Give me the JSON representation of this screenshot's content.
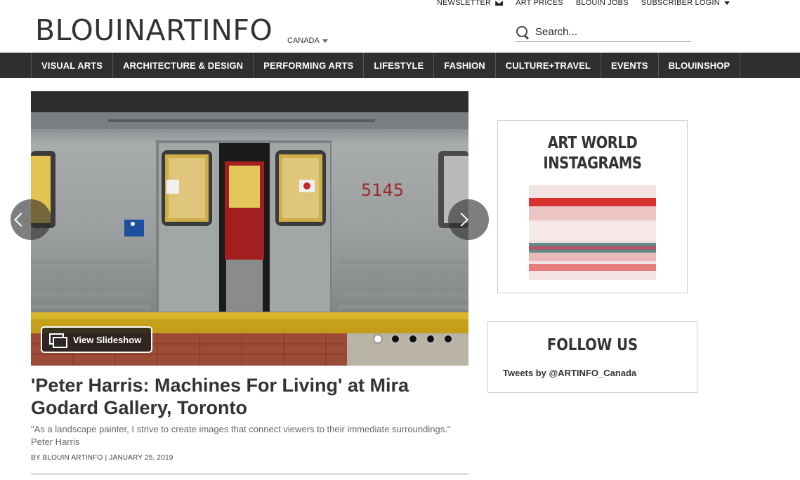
{
  "utility_links": {
    "newsletter": "NEWSLETTER",
    "art_prices": "ART PRICES",
    "blouin_jobs": "BLOUIN JOBS",
    "subscriber_login": "SUBSCRIBER LOGIN"
  },
  "logo": {
    "text": "BLOUINARTINFO"
  },
  "edition": {
    "label": "CANADA"
  },
  "search": {
    "placeholder": "Search..."
  },
  "nav": {
    "items": [
      "VISUAL ARTS",
      "ARCHITECTURE & DESIGN",
      "PERFORMING ARTS",
      "LIFESTYLE",
      "FASHION",
      "CULTURE+TRAVEL",
      "EVENTS",
      "BLOUINSHOP"
    ]
  },
  "hero": {
    "train_number": "5145",
    "slideshow_label": "View Slideshow",
    "slide_count": 5,
    "active_slide": 1
  },
  "article": {
    "headline": "'Peter Harris: Machines For Living' at Mira Godard Gallery, Toronto",
    "dek": "\"As a landscape painter, I strive to create images that connect viewers to their immediate surroundings.\" Peter Harris",
    "byline": "BY BLOUIN ARTINFO | JANUARY 25, 2019"
  },
  "sidebar": {
    "instagram_title": "ART WORLD INSTAGRAMS",
    "follow_title": "FOLLOW US",
    "tweets_label": "Tweets by @ARTINFO_Canada"
  },
  "colors": {
    "nav_bg": "#2f2f2f",
    "text": "#333333",
    "accent_red": "#d9332f"
  }
}
